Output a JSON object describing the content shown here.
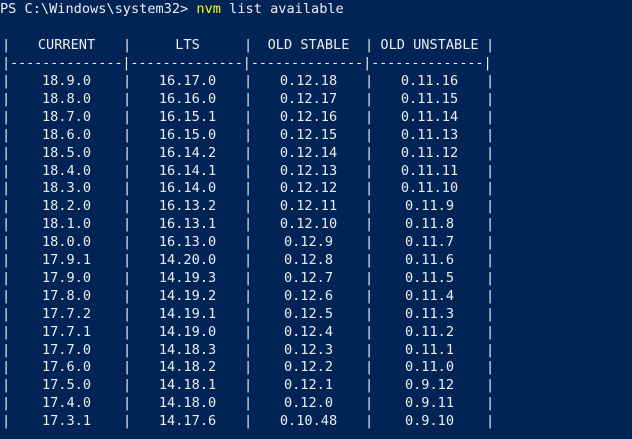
{
  "prompt": {
    "text": "PS C:\\Windows\\system32> ",
    "command": "nvm",
    "arguments": " list available"
  },
  "table": {
    "columns": [
      "CURRENT",
      "LTS",
      "OLD STABLE",
      "OLD UNSTABLE"
    ],
    "separator": "|--------------|--------------|--------------|--------------|",
    "rows": [
      [
        "18.9.0",
        "16.17.0",
        "0.12.18",
        "0.11.16"
      ],
      [
        "18.8.0",
        "16.16.0",
        "0.12.17",
        "0.11.15"
      ],
      [
        "18.7.0",
        "16.15.1",
        "0.12.16",
        "0.11.14"
      ],
      [
        "18.6.0",
        "16.15.0",
        "0.12.15",
        "0.11.13"
      ],
      [
        "18.5.0",
        "16.14.2",
        "0.12.14",
        "0.11.12"
      ],
      [
        "18.4.0",
        "16.14.1",
        "0.12.13",
        "0.11.11"
      ],
      [
        "18.3.0",
        "16.14.0",
        "0.12.12",
        "0.11.10"
      ],
      [
        "18.2.0",
        "16.13.2",
        "0.12.11",
        "0.11.9"
      ],
      [
        "18.1.0",
        "16.13.1",
        "0.12.10",
        "0.11.8"
      ],
      [
        "18.0.0",
        "16.13.0",
        "0.12.9",
        "0.11.7"
      ],
      [
        "17.9.1",
        "14.20.0",
        "0.12.8",
        "0.11.6"
      ],
      [
        "17.9.0",
        "14.19.3",
        "0.12.7",
        "0.11.5"
      ],
      [
        "17.8.0",
        "14.19.2",
        "0.12.6",
        "0.11.4"
      ],
      [
        "17.7.2",
        "14.19.1",
        "0.12.5",
        "0.11.3"
      ],
      [
        "17.7.1",
        "14.19.0",
        "0.12.4",
        "0.11.2"
      ],
      [
        "17.7.0",
        "14.18.3",
        "0.12.3",
        "0.11.1"
      ],
      [
        "17.6.0",
        "14.18.2",
        "0.12.2",
        "0.11.0"
      ],
      [
        "17.5.0",
        "14.18.1",
        "0.12.1",
        "0.9.12"
      ],
      [
        "17.4.0",
        "14.18.0",
        "0.12.0",
        "0.9.11"
      ],
      [
        "17.3.1",
        "14.17.6",
        "0.10.48",
        "0.9.10"
      ]
    ]
  },
  "colors": {
    "background": "#012456",
    "text": "#eeedf0",
    "command": "#ffff00"
  }
}
